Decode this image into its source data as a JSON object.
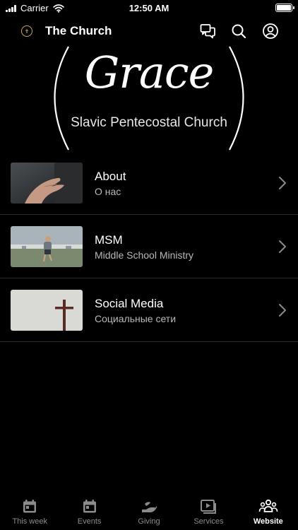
{
  "status_bar": {
    "carrier": "Carrier",
    "time": "12:50 AM"
  },
  "header": {
    "title": "The Church",
    "logo_icon": "church-logo-icon",
    "icons": [
      "chat-icon",
      "search-icon",
      "profile-icon"
    ]
  },
  "hero": {
    "script_title": "Grace",
    "subtitle": "Slavic Pentecostal Church"
  },
  "list": [
    {
      "title": "About",
      "subtitle": "О нас",
      "thumb": "open-hand-photo"
    },
    {
      "title": "MSM",
      "subtitle": "Middle School Ministry",
      "thumb": "child-running-field-photo"
    },
    {
      "title": "Social Media",
      "subtitle": "Социальные сети",
      "thumb": "cross-photo"
    }
  ],
  "tabs": [
    {
      "label": "This week",
      "icon": "calendar-icon",
      "active": false
    },
    {
      "label": "Events",
      "icon": "calendar-icon",
      "active": false
    },
    {
      "label": "Giving",
      "icon": "giving-hand-icon",
      "active": false
    },
    {
      "label": "Services",
      "icon": "video-play-icon",
      "active": false
    },
    {
      "label": "Website",
      "icon": "people-group-icon",
      "active": true
    }
  ],
  "colors": {
    "background": "#000000",
    "text": "#ffffff",
    "subtext": "#b9b9b9",
    "inactive_tab": "#8b8b8b",
    "logo_gold": "#c6a96a"
  }
}
